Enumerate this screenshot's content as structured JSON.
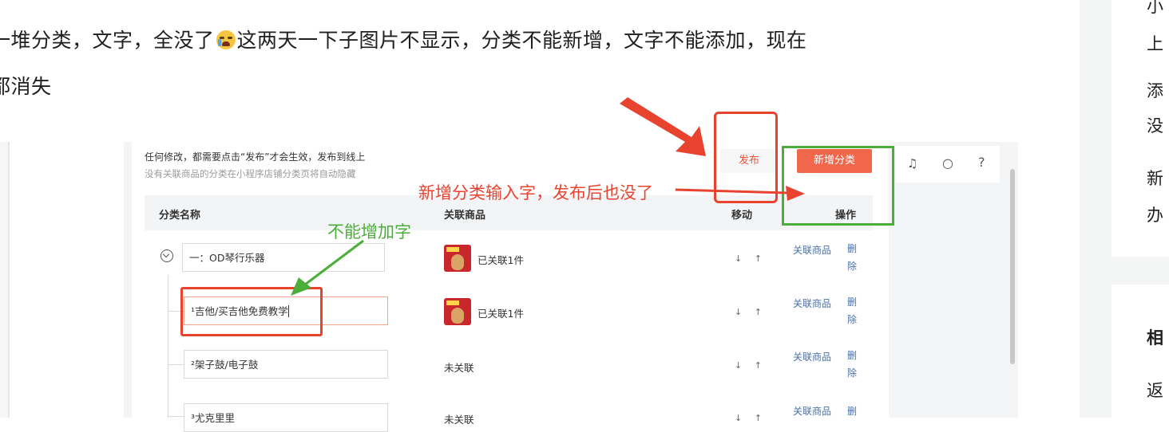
{
  "post": {
    "line1_a": "一堆分类，文字，全没了",
    "line1_b": "这两天一下子图片不显示，分类不能新增，文字不能添加，现在",
    "line2": "都消失",
    "emoji_icon": "loudly-crying-face-emoji"
  },
  "shot": {
    "notice": "任何修改，都需要点击“发布”才会生效，发布到线上",
    "sub_notice": "没有关联商品的分类在小程序店铺分类页将自动隐藏",
    "publish_label": "发布",
    "add_category_label": "新增分类",
    "columns": {
      "name": "分类名称",
      "products": "关联商品",
      "move": "移动",
      "ops": "操作"
    },
    "rows": [
      {
        "name": "一：OD琴行乐器",
        "products": "已关联1件",
        "move": "↓ ↑",
        "op_link": "关联商品",
        "op_delete": "删除"
      },
      {
        "name": "¹吉他/买吉他免费教学",
        "products": "已关联1件",
        "move": "↓ ↑",
        "op_link": "关联商品",
        "op_delete": "删除"
      },
      {
        "name": "²架子鼓/电子鼓",
        "products": "未关联",
        "move": "↓ ↑",
        "op_link": "关联商品",
        "op_delete": "删除"
      },
      {
        "name": "³尤克里里",
        "products": "未关联",
        "move": "↓ ↑",
        "op_link": "关联商品",
        "op_delete": "删"
      }
    ],
    "icons": [
      "bell-icon",
      "chat-icon",
      "help-icon"
    ],
    "annotations": {
      "red": "新增分类输入字，发布后也没了",
      "green": "不能增加字"
    },
    "colors": {
      "annotation_red": "#e8432f",
      "annotation_green": "#4cae3a",
      "primary_button": "#f0674c"
    }
  },
  "sidebar": {
    "frag": [
      "小",
      "上",
      "添",
      "没",
      "新",
      "办",
      "相",
      "返"
    ]
  }
}
